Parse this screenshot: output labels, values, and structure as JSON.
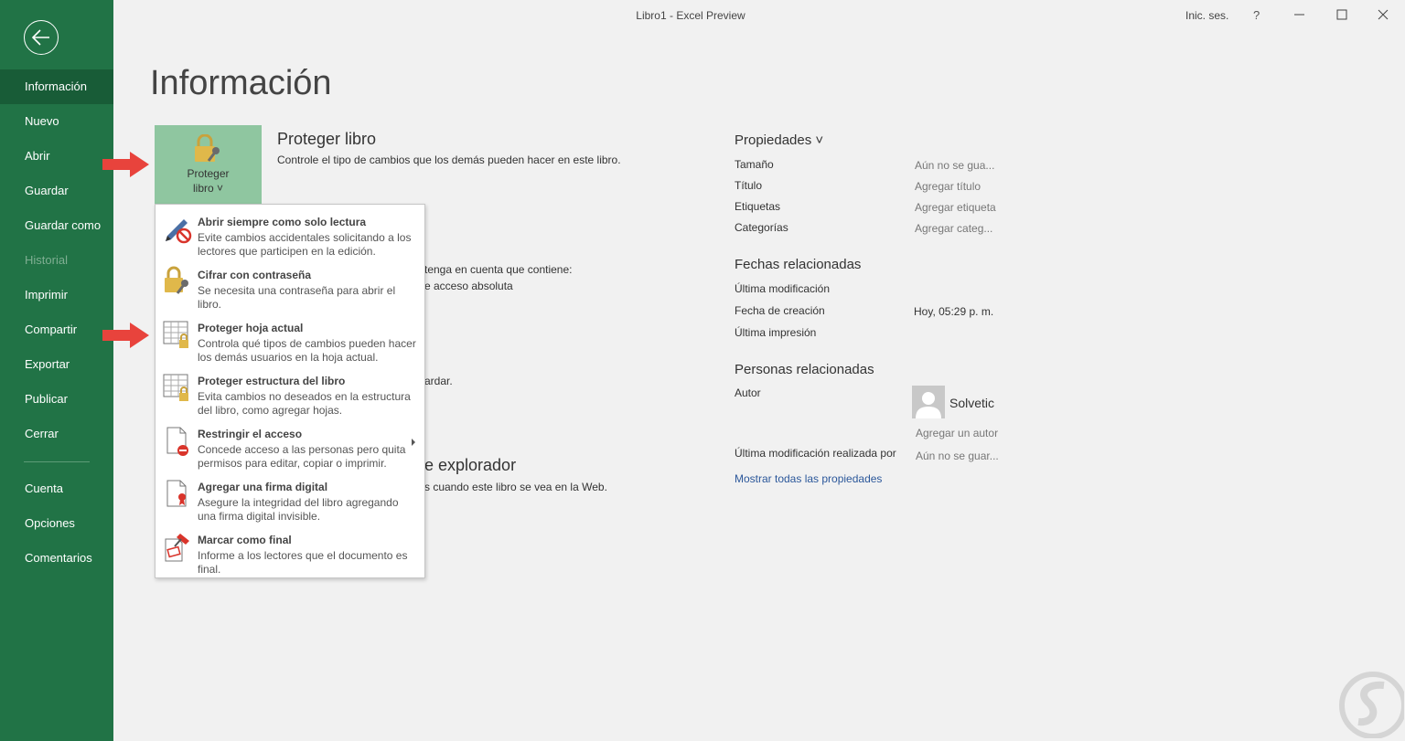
{
  "titlebar": {
    "title": "Libro1  -  Excel Preview",
    "signin": "Inic. ses.",
    "help": "?"
  },
  "sidebar": {
    "items": [
      {
        "label": "Información",
        "active": true
      },
      {
        "label": "Nuevo"
      },
      {
        "label": "Abrir"
      },
      {
        "label": "Guardar"
      },
      {
        "label": "Guardar como"
      },
      {
        "label": "Historial",
        "disabled": true
      },
      {
        "label": "Imprimir"
      },
      {
        "label": "Compartir"
      },
      {
        "label": "Exportar"
      },
      {
        "label": "Publicar"
      },
      {
        "label": "Cerrar"
      },
      {
        "label": "Cuenta"
      },
      {
        "label": "Opciones"
      },
      {
        "label": "Comentarios"
      }
    ]
  },
  "page": {
    "title": "Información",
    "protect": {
      "button_line1": "Proteger",
      "button_line2": "libro ˅",
      "title": "Proteger libro",
      "desc": "Controle el tipo de cambios que los demás pueden hacer en este libro."
    },
    "background": {
      "line1": "tenga en cuenta que contiene:",
      "line2": "e acceso absoluta",
      "line3": "ardar.",
      "heading": "e explorador",
      "line4": "s cuando este libro se vea en la Web."
    }
  },
  "dropdown": {
    "items": [
      {
        "title": "Abrir siempre como solo lectura",
        "desc": "Evite cambios accidentales solicitando a los lectores que participen en la edición.",
        "icon": "pen-no-icon"
      },
      {
        "title": "Cifrar con contraseña",
        "desc": "Se necesita una contraseña para abrir el libro.",
        "icon": "lock-key-icon"
      },
      {
        "title": "Proteger hoja actual",
        "desc": "Controla qué tipos de cambios pueden hacer los demás usuarios en la hoja actual.",
        "icon": "sheet-lock-icon"
      },
      {
        "title": "Proteger estructura del libro",
        "desc": "Evita cambios no deseados en la estructura del libro, como agregar hojas.",
        "icon": "workbook-lock-icon"
      },
      {
        "title": "Restringir el acceso",
        "desc": "Concede acceso a las personas pero quita permisos para editar, copiar o imprimir.",
        "icon": "document-restrict-icon"
      },
      {
        "title": "Agregar una firma digital",
        "desc": "Asegure la integridad del libro agregando una firma digital invisible.",
        "icon": "document-ribbon-icon"
      },
      {
        "title": "Marcar como final",
        "desc": "Informe a los lectores que el documento es final.",
        "icon": "document-stamp-icon"
      }
    ]
  },
  "properties": {
    "title": "Propiedades ˅",
    "rows": [
      {
        "label": "Tamaño",
        "value": "Aún no se gua..."
      },
      {
        "label": "Título",
        "value": "Agregar título"
      },
      {
        "label": "Etiquetas",
        "value": "Agregar etiqueta"
      },
      {
        "label": "Categorías",
        "value": "Agregar categ..."
      }
    ],
    "dates_title": "Fechas relacionadas",
    "dates": [
      {
        "label": "Última modificación",
        "value": ""
      },
      {
        "label": "Fecha de creación",
        "value": "Hoy, 05:29 p. m."
      },
      {
        "label": "Última impresión",
        "value": ""
      }
    ],
    "people_title": "Personas relacionadas",
    "author_label": "Autor",
    "author_name": "Solvetic",
    "add_author": "Agregar un autor",
    "last_modified_by_label": "Última modificación realizada por",
    "last_modified_by_value": "Aún no se guar...",
    "show_all": "Mostrar todas las propiedades"
  },
  "colors": {
    "accent": "#217346",
    "active": "#185c37",
    "button": "#8fc6a0",
    "arrow": "#e8433c",
    "link": "#2b579a"
  }
}
